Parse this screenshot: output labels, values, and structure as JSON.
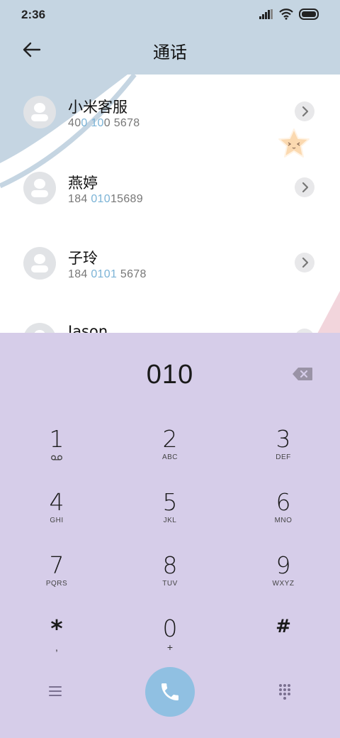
{
  "status_bar": {
    "time": "2:36",
    "icons": [
      "signal-icon",
      "wifi-icon",
      "battery-icon"
    ]
  },
  "header": {
    "title": "通话",
    "back_icon": "arrow-left-icon"
  },
  "contacts": [
    {
      "name": "小米客服",
      "number_parts": [
        "40",
        "0",
        " ",
        "10",
        "0 5678"
      ]
    },
    {
      "name": "燕婷",
      "number_parts": [
        "184 ",
        "010",
        "",
        "",
        "15689"
      ]
    },
    {
      "name": "子玲",
      "number_parts": [
        "184 ",
        "010",
        "",
        "1",
        " 5678"
      ]
    },
    {
      "name": "Jason",
      "number_parts": [
        "",
        "",
        "",
        "",
        ""
      ]
    }
  ],
  "dialpad": {
    "input_value": "010",
    "keys": [
      {
        "digit": "1",
        "sub": "voicemail-icon"
      },
      {
        "digit": "2",
        "sub": "ABC"
      },
      {
        "digit": "3",
        "sub": "DEF"
      },
      {
        "digit": "4",
        "sub": "GHI"
      },
      {
        "digit": "5",
        "sub": "JKL"
      },
      {
        "digit": "6",
        "sub": "MNO"
      },
      {
        "digit": "7",
        "sub": "PQRS"
      },
      {
        "digit": "8",
        "sub": "TUV"
      },
      {
        "digit": "9",
        "sub": "WXYZ"
      },
      {
        "digit": "*",
        "sub": ","
      },
      {
        "digit": "0",
        "sub": "+"
      },
      {
        "digit": "#",
        "sub": ""
      }
    ]
  },
  "colors": {
    "header_bg": "#c5d5e2",
    "dialpad_bg": "#d6cde9",
    "call_button": "#90c0e2",
    "highlight": "#7bb3d6",
    "pink_accent": "#f2d5dc"
  }
}
